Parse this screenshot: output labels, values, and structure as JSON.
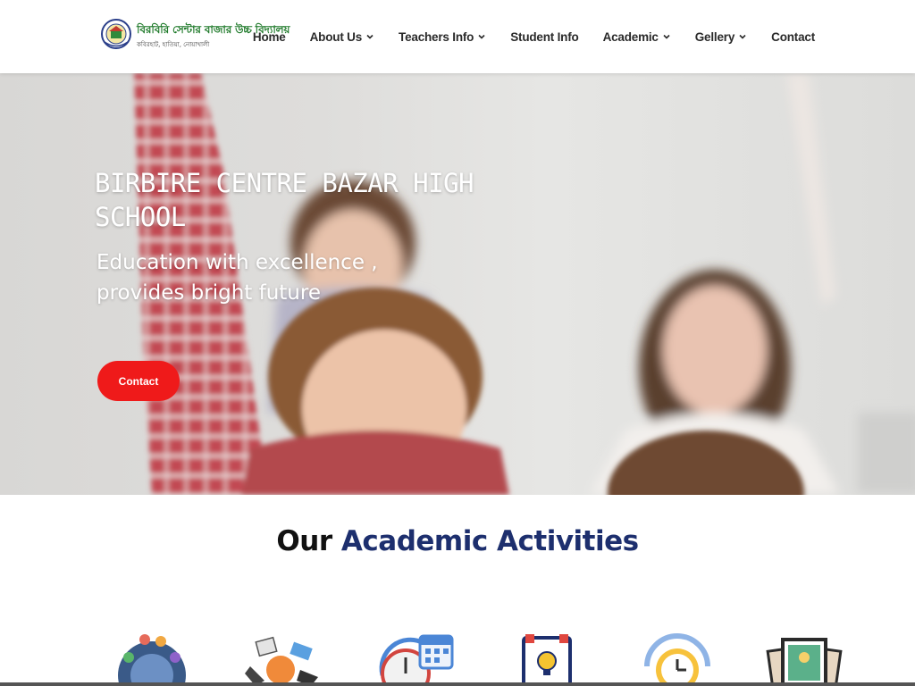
{
  "header": {
    "logo_title": "বিরবিরি সেন্টার বাজার উচ্চ বিদ্যালয়",
    "logo_subtitle": "কবিরহাট, হাতিয়া, নোয়াখালী",
    "nav": [
      {
        "label": "Home",
        "dropdown": false
      },
      {
        "label": "About Us",
        "dropdown": true
      },
      {
        "label": "Teachers Info",
        "dropdown": true
      },
      {
        "label": "Student Info",
        "dropdown": false
      },
      {
        "label": "Academic",
        "dropdown": true
      },
      {
        "label": "Gellery",
        "dropdown": true
      },
      {
        "label": "Contact",
        "dropdown": false
      }
    ]
  },
  "hero": {
    "title": "BIRBIRE CENTRE BAZAR HIGH SCHOOL",
    "subtitle": "Education with excellence , provides bright future",
    "button_label": "Contact"
  },
  "section": {
    "title_part1": "Our",
    "title_part2": "Academic Activities"
  },
  "activities": [
    {
      "icon": "students-group-icon"
    },
    {
      "icon": "learning-tools-icon"
    },
    {
      "icon": "calendar-schedule-icon"
    },
    {
      "icon": "idea-clipboard-icon"
    },
    {
      "icon": "clock-icon"
    },
    {
      "icon": "photo-gallery-icon"
    }
  ],
  "colors": {
    "logo_green": "#1f7a2a",
    "accent_red": "#ef1a1a",
    "title_navy": "#1d2f6e"
  }
}
